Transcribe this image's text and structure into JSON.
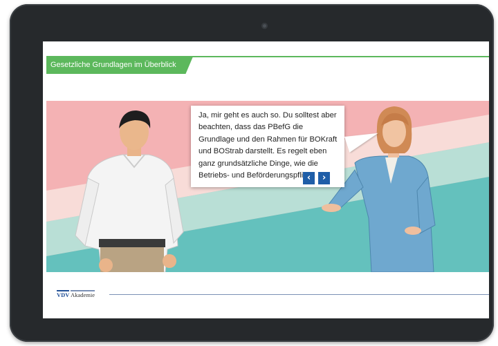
{
  "window": {
    "header_title": "Gesetzliche Grundlagen im Überblick"
  },
  "dialog": {
    "speech_text": "Ja, mir geht es auch so. Du solltest aber beachten, dass das PBefG die Grundlage und den Rahmen für BOKraft und BOStrab darstellt. Es regelt eben ganz grundsätzliche Dinge, wie die Betriebs- und Beförderungspflicht.",
    "prev_glyph": "‹",
    "next_glyph": "›"
  },
  "footer": {
    "logo_vdv": "VDV",
    "logo_akademie": "Akademie"
  },
  "colors": {
    "accent_green": "#5cb85c",
    "nav_blue": "#1f5ea8",
    "band_pink": "#f4b2b4",
    "band_light_pink": "#f8dcd8",
    "band_mint": "#b9dfd6",
    "band_teal": "#64c1bd"
  }
}
